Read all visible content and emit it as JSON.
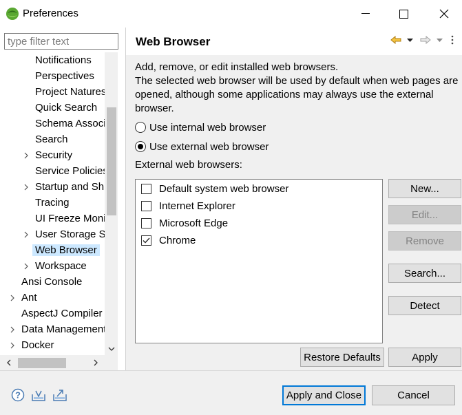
{
  "window": {
    "title": "Preferences"
  },
  "filter": {
    "placeholder": "type filter text",
    "value": ""
  },
  "tree": [
    {
      "label": "Notifications",
      "expandable": false
    },
    {
      "label": "Perspectives",
      "expandable": false
    },
    {
      "label": "Project Natures",
      "expandable": false
    },
    {
      "label": "Quick Search",
      "expandable": false
    },
    {
      "label": "Schema Associations",
      "expandable": false
    },
    {
      "label": "Search",
      "expandable": false
    },
    {
      "label": "Security",
      "expandable": true
    },
    {
      "label": "Service Policies",
      "expandable": false
    },
    {
      "label": "Startup and Shutdown",
      "expandable": true
    },
    {
      "label": "Tracing",
      "expandable": false
    },
    {
      "label": "UI Freeze Monitoring",
      "expandable": false
    },
    {
      "label": "User Storage Service",
      "expandable": true
    },
    {
      "label": "Web Browser",
      "expandable": false,
      "selected": true
    },
    {
      "label": "Workspace",
      "expandable": true
    },
    {
      "label": "Ansi Console",
      "expandable": false
    },
    {
      "label": "Ant",
      "expandable": true
    },
    {
      "label": "AspectJ Compiler",
      "expandable": false
    },
    {
      "label": "Data Management",
      "expandable": true
    },
    {
      "label": "Docker",
      "expandable": true
    }
  ],
  "page": {
    "title": "Web Browser",
    "description": "Add, remove, or edit installed web browsers.\nThe selected web browser will be used by default when web pages are opened, although some applications may always use the external browser.",
    "radio_internal": "Use internal web browser",
    "radio_external": "Use external web browser",
    "selected_mode": "external",
    "browsers_label": "External web browsers:",
    "browsers": [
      {
        "name": "Default system web browser",
        "checked": false
      },
      {
        "name": "Internet Explorer",
        "checked": false
      },
      {
        "name": "Microsoft Edge",
        "checked": false
      },
      {
        "name": "Chrome",
        "checked": true
      }
    ],
    "buttons": {
      "new": "New...",
      "edit": "Edit...",
      "remove": "Remove",
      "search": "Search...",
      "detect": "Detect",
      "restore_defaults": "Restore Defaults",
      "apply": "Apply"
    }
  },
  "footer": {
    "apply_close": "Apply and Close",
    "cancel": "Cancel"
  },
  "colors": {
    "selection": "#cce8ff",
    "accent": "#0078d7",
    "nav_back": "#e8b030"
  }
}
